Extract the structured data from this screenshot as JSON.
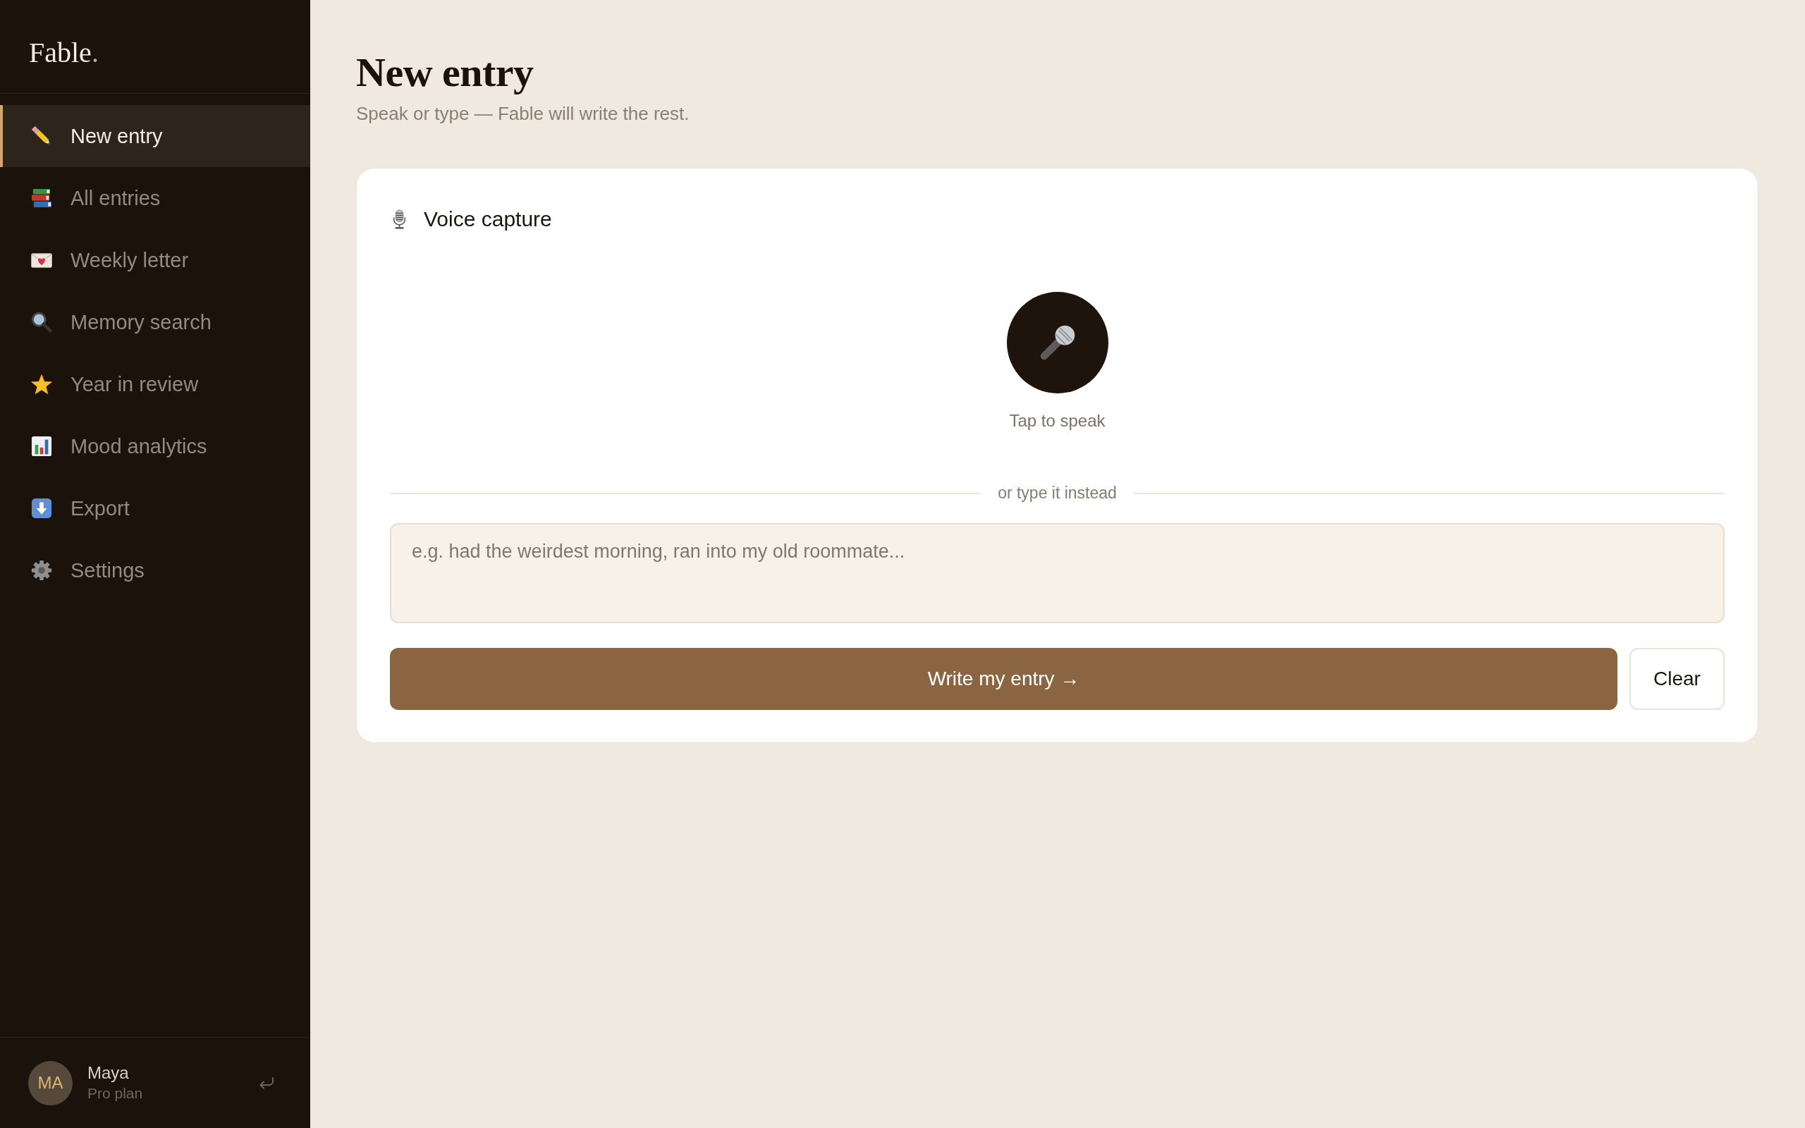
{
  "sidebar": {
    "logo": {
      "name": "Fable",
      "accent": "."
    },
    "nav": [
      {
        "label": "New entry",
        "selected": true
      },
      {
        "label": "All entries",
        "selected": false
      },
      {
        "label": "Weekly letter",
        "selected": false
      },
      {
        "label": "Memory search",
        "selected": false
      },
      {
        "label": "Year in review",
        "selected": false
      },
      {
        "label": "Mood analytics",
        "selected": false
      },
      {
        "label": "Export",
        "selected": false
      },
      {
        "label": "Settings",
        "selected": false
      }
    ],
    "user": {
      "initials": "MA",
      "name": "Maya",
      "plan": "Pro plan"
    }
  },
  "header": {
    "title": "New entry",
    "subtitle": "Speak or type — Fable will write the rest."
  },
  "voice_card": {
    "title": "Voice capture",
    "mic_label": "Tap to speak",
    "divider": "or type it instead",
    "entry_field": {
      "placeholder": "e.g. had the weirdest morning, ran into my old roommate..."
    },
    "buttons": [
      {
        "label": "Write my entry →",
        "kind": "submit"
      },
      {
        "label": "Clear",
        "kind": "clear"
      }
    ]
  }
}
